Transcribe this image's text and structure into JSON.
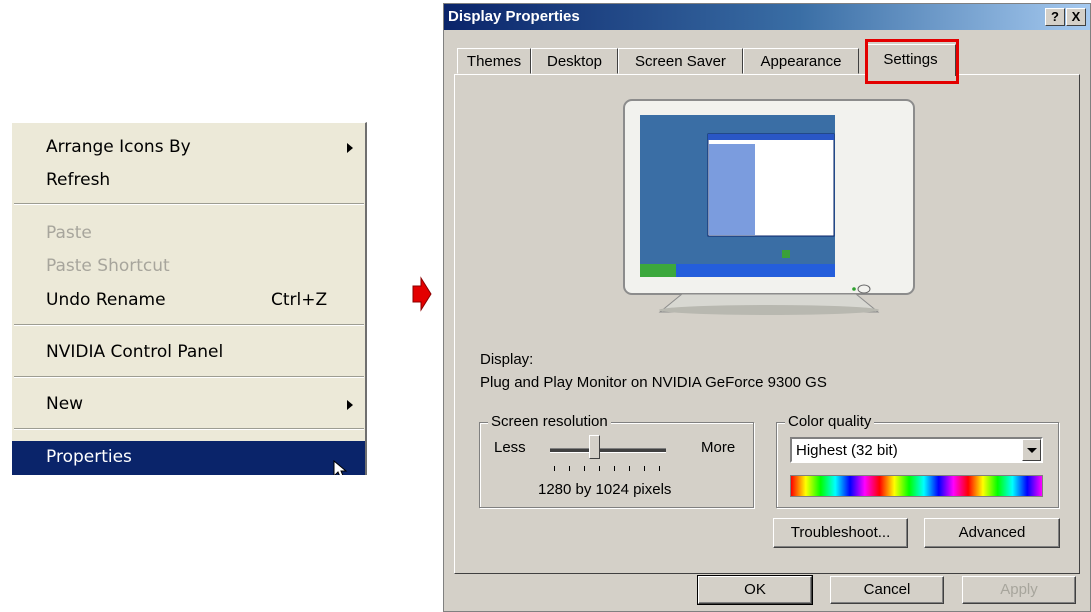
{
  "context_menu": {
    "items": [
      {
        "label": "Arrange Icons By"
      },
      {
        "label": "Refresh"
      },
      {
        "label": "Paste"
      },
      {
        "label": "Paste Shortcut"
      },
      {
        "label": "Undo Rename",
        "shortcut": "Ctrl+Z"
      },
      {
        "label": "NVIDIA Control Panel"
      },
      {
        "label": "New"
      },
      {
        "label": "Properties"
      }
    ]
  },
  "dialog": {
    "title": "Display Properties",
    "help_button": "?",
    "close_button": "X",
    "tabs": [
      {
        "label": "Themes"
      },
      {
        "label": "Desktop"
      },
      {
        "label": "Screen Saver"
      },
      {
        "label": "Appearance"
      },
      {
        "label": "Settings"
      }
    ],
    "display_label": "Display:",
    "display_value": "Plug and Play Monitor on NVIDIA GeForce 9300 GS",
    "resolution": {
      "group_label": "Screen resolution",
      "less": "Less",
      "more": "More",
      "value_text": "1280 by 1024 pixels",
      "slider_fraction": 0.38
    },
    "color_quality": {
      "group_label": "Color quality",
      "selected": "Highest (32 bit)"
    },
    "buttons": {
      "troubleshoot": "Troubleshoot...",
      "advanced": "Advanced",
      "ok": "OK",
      "cancel": "Cancel",
      "apply": "Apply"
    }
  },
  "colors": {
    "menu_highlight": "#0a246a",
    "tab_highlight": "#e30000",
    "arrow": "#e30000",
    "monitor_screen": "#3a6ea5"
  }
}
